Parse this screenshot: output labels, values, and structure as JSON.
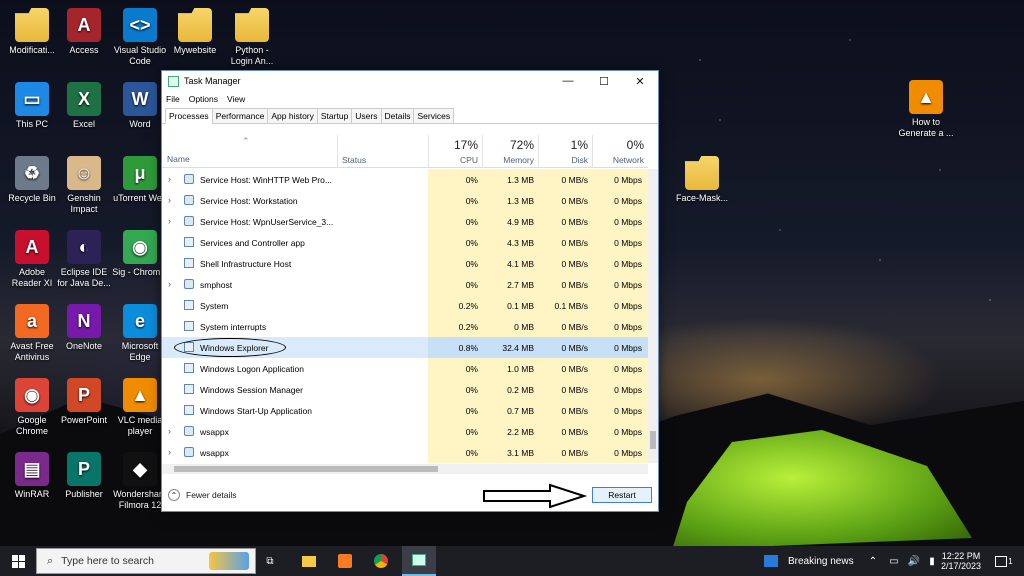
{
  "desktop": {
    "icons": [
      {
        "label": "Modificati...",
        "kind": "folder"
      },
      {
        "label": "Access",
        "kind": "app",
        "color": "#a4262c",
        "glyph": "A"
      },
      {
        "label": "Visual Studio Code",
        "kind": "app",
        "color": "#0a7acc",
        "glyph": "<>"
      },
      {
        "label": "Mywebsite",
        "kind": "folder"
      },
      {
        "label": "Python - Login An...",
        "kind": "folder"
      },
      {
        "label": "This PC",
        "kind": "app",
        "color": "#1e88e5",
        "glyph": "▭"
      },
      {
        "label": "Excel",
        "kind": "app",
        "color": "#1e7145",
        "glyph": "X"
      },
      {
        "label": "Word",
        "kind": "app",
        "color": "#2b579a",
        "glyph": "W"
      },
      {
        "label": "Recycle Bin",
        "kind": "app",
        "color": "#6c7a89",
        "glyph": "♻"
      },
      {
        "label": "Genshin Impact",
        "kind": "app",
        "color": "#d9b98a",
        "glyph": "☺"
      },
      {
        "label": "uTorrent Web",
        "kind": "app",
        "color": "#2e9b3a",
        "glyph": "μ"
      },
      {
        "label": "Adobe Reader XI",
        "kind": "app",
        "color": "#c8102e",
        "glyph": "A"
      },
      {
        "label": "Eclipse IDE for Java De...",
        "kind": "app",
        "color": "#2c2255",
        "glyph": "◐"
      },
      {
        "label": "Sig - Chrom...",
        "kind": "app",
        "color": "#34a853",
        "glyph": "◉"
      },
      {
        "label": "Avast Free Antivirus",
        "kind": "app",
        "color": "#f26a21",
        "glyph": "a"
      },
      {
        "label": "OneNote",
        "kind": "app",
        "color": "#7719aa",
        "glyph": "N"
      },
      {
        "label": "Microsoft Edge",
        "kind": "app",
        "color": "#0c8ddb",
        "glyph": "e"
      },
      {
        "label": "Google Chrome",
        "kind": "app",
        "color": "#db4437",
        "glyph": "◉"
      },
      {
        "label": "PowerPoint",
        "kind": "app",
        "color": "#d24726",
        "glyph": "P"
      },
      {
        "label": "VLC media player",
        "kind": "app",
        "color": "#f08c00",
        "glyph": "▲"
      },
      {
        "label": "WinRAR",
        "kind": "app",
        "color": "#7b2a8c",
        "glyph": "▤"
      },
      {
        "label": "Publisher",
        "kind": "app",
        "color": "#077568",
        "glyph": "P"
      },
      {
        "label": "Wondershare Filmora 12",
        "kind": "app",
        "color": "#111",
        "glyph": "◆"
      },
      {
        "label": "How to Generate a ...",
        "kind": "app",
        "color": "#f08c00",
        "glyph": "▲"
      },
      {
        "label": "Face-Mask...",
        "kind": "folder"
      }
    ]
  },
  "task_manager": {
    "title": "Task Manager",
    "controls": {
      "minimize": "—",
      "maximize": "☐",
      "close": "✕"
    },
    "menu": [
      "File",
      "Options",
      "View"
    ],
    "tabs": [
      "Processes",
      "Performance",
      "App history",
      "Startup",
      "Users",
      "Details",
      "Services"
    ],
    "active_tab": "Processes",
    "columns": {
      "name": "Name",
      "status": "Status",
      "cpu": {
        "pct": "17%",
        "label": "CPU"
      },
      "memory": {
        "pct": "72%",
        "label": "Memory"
      },
      "disk": {
        "pct": "1%",
        "label": "Disk"
      },
      "network": {
        "pct": "0%",
        "label": "Network"
      }
    },
    "rows": [
      {
        "name": "Service Host: WinHTTP Web Pro...",
        "expand": true,
        "cpu": "0%",
        "mem": "1.3 MB",
        "disk": "0 MB/s",
        "net": "0 Mbps"
      },
      {
        "name": "Service Host: Workstation",
        "expand": true,
        "cpu": "0%",
        "mem": "1.3 MB",
        "disk": "0 MB/s",
        "net": "0 Mbps"
      },
      {
        "name": "Service Host: WpnUserService_3...",
        "expand": true,
        "cpu": "0%",
        "mem": "4.9 MB",
        "disk": "0 MB/s",
        "net": "0 Mbps"
      },
      {
        "name": "Services and Controller app",
        "expand": false,
        "cpu": "0%",
        "mem": "4.3 MB",
        "disk": "0 MB/s",
        "net": "0 Mbps"
      },
      {
        "name": "Shell Infrastructure Host",
        "expand": false,
        "cpu": "0%",
        "mem": "4.1 MB",
        "disk": "0 MB/s",
        "net": "0 Mbps"
      },
      {
        "name": "smphost",
        "expand": true,
        "cpu": "0%",
        "mem": "2.7 MB",
        "disk": "0 MB/s",
        "net": "0 Mbps"
      },
      {
        "name": "System",
        "expand": false,
        "cpu": "0.2%",
        "mem": "0.1 MB",
        "disk": "0.1 MB/s",
        "net": "0 Mbps"
      },
      {
        "name": "System interrupts",
        "expand": false,
        "cpu": "0.2%",
        "mem": "0 MB",
        "disk": "0 MB/s",
        "net": "0 Mbps"
      },
      {
        "name": "Windows Explorer",
        "expand": false,
        "cpu": "0.8%",
        "mem": "32.4 MB",
        "disk": "0 MB/s",
        "net": "0 Mbps",
        "selected": true
      },
      {
        "name": "Windows Logon Application",
        "expand": false,
        "cpu": "0%",
        "mem": "1.0 MB",
        "disk": "0 MB/s",
        "net": "0 Mbps"
      },
      {
        "name": "Windows Session Manager",
        "expand": false,
        "cpu": "0%",
        "mem": "0.2 MB",
        "disk": "0 MB/s",
        "net": "0 Mbps"
      },
      {
        "name": "Windows Start-Up Application",
        "expand": false,
        "cpu": "0%",
        "mem": "0.7 MB",
        "disk": "0 MB/s",
        "net": "0 Mbps"
      },
      {
        "name": "wsappx",
        "expand": true,
        "cpu": "0%",
        "mem": "2.2 MB",
        "disk": "0 MB/s",
        "net": "0 Mbps"
      },
      {
        "name": "wsappx",
        "expand": true,
        "cpu": "0%",
        "mem": "3.1 MB",
        "disk": "0 MB/s",
        "net": "0 Mbps"
      }
    ],
    "fewer_details": "Fewer details",
    "restart": "Restart"
  },
  "taskbar": {
    "search_placeholder": "Type here to search",
    "news": "Breaking news",
    "time": "12:22 PM",
    "date": "2/17/2023",
    "notification_count": "1"
  }
}
